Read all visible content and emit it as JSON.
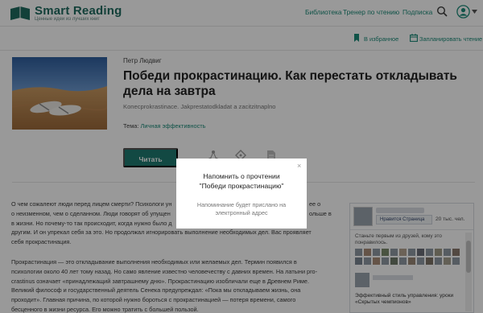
{
  "header": {
    "logo": {
      "name": "Smart Reading",
      "tagline": "Ценные идеи из лучших книг"
    },
    "nav": [
      {
        "label": "Библиотека"
      },
      {
        "label": "Тренер по чтению"
      },
      {
        "label": "Подписка"
      }
    ],
    "icons": {
      "search": "search-icon",
      "avatar": "user-avatar-icon",
      "caret": "chevron-down-icon"
    }
  },
  "actions": {
    "favorite_label": "В избранное",
    "schedule_label": "Запланировать чтение"
  },
  "book": {
    "author": "Петр Людвиг",
    "title": "Победи прокрастинацию. Как перестать откладывать дела на завтра",
    "tags": "Konecprokrastinace. Jakprestatodkladat a zacitzitnaplno",
    "theme_label": "Тема:",
    "theme_value": "Личная эффективность",
    "read_button": "Читать"
  },
  "article": {
    "para1": [
      "О чем сожалеют люди перед лицем смерти? Психологи ун",
      "о неизменном, чем о сделанном. Люди говорят об упущен",
      "в жизни. Но почему-то так происходит, когда нужно было д",
      "другим. И он упрекал себя за это. Но продолжал игнорировать выполнение необходимых дел. Вас проявляет",
      "себя прокрастинация."
    ],
    "para1_right": [
      "ее о",
      "ольше в",
      ""
    ],
    "para2": [
      "Прокрастинация — это откладывание выполнения необходимых или желаемых дел. Термин появился в",
      "психологии около 40 лет тому назад. Но само явление известно человечеству с давних времен. На латыни pro-",
      "crastinus означает «принадлежащий завтрашнему дню». Прокрастинацию изобличали еще в Древнем Риме.",
      "Великий философ и государственный деятель Сенека предупреждал: «Пока мы откладываем жизнь, она",
      "проходит». Главная причина, по которой нужно бороться с прокрастинацией — потеря времени, самого",
      "бесценного в жизни ресурса. Его можно тратить с большей пользой."
    ]
  },
  "widget": {
    "like_label": "Нравится Страница",
    "count": "20 тыс. чел.",
    "friends_text": "Станьте первым из друзей, кому это понравилось.",
    "post_text": "Эффективный стиль управления: уроки «Скрытых чемпионов»"
  },
  "modal": {
    "title_line1": "Напомнить о прочтении",
    "title_line2": "\"Победи прокрастинацию\"",
    "message_line1": "Напоминание будет прислано на",
    "message_line2": "электронный адрес",
    "close": "×"
  },
  "colors": {
    "accent": "#1b8b79",
    "button": "#1e7a70",
    "overlay": "rgba(0,0,0,0.40)"
  }
}
